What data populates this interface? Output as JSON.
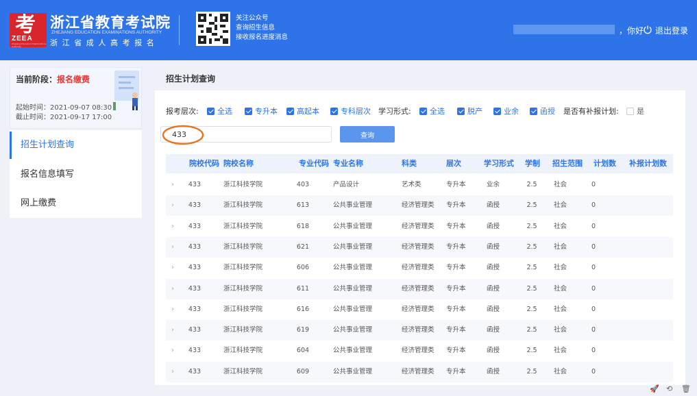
{
  "header": {
    "org_name": "浙江省教育考试院",
    "org_en": "ZHEJIANG EDUCATION EXAMINATIONS AUTHORITY",
    "org_sub": "浙江省成人高考报名",
    "logo_char": "考",
    "logo_text": "ZEEA",
    "logo_small": "Zhejiang Education Examinations Authority",
    "qr_lines": [
      "关注公众号",
      "查询招生信息",
      "接收报名进度消息"
    ],
    "greeting": "，你好",
    "logout": "退出登录"
  },
  "sidebar": {
    "stage_label": "当前阶段：",
    "stage_value": "报名缴费",
    "start_time": "起始时间：2021-09-07 08:30",
    "end_time": "截止时间：2021-09-17 17:00",
    "items": [
      {
        "label": "招生计划查询",
        "active": true
      },
      {
        "label": "报名信息填写",
        "active": false
      },
      {
        "label": "网上缴费",
        "active": false
      }
    ]
  },
  "main": {
    "title": "招生计划查询",
    "filters": {
      "level_label": "报考层次:",
      "level_options": [
        {
          "label": "全选",
          "checked": true
        },
        {
          "label": "专升本",
          "checked": true
        },
        {
          "label": "高起本",
          "checked": true
        },
        {
          "label": "专科层次",
          "checked": true
        }
      ],
      "form_label": "学习形式:",
      "form_options": [
        {
          "label": "全选",
          "checked": true
        },
        {
          "label": "脱产",
          "checked": true
        },
        {
          "label": "业余",
          "checked": true
        },
        {
          "label": "函授",
          "checked": true
        }
      ],
      "supplement_label": "是否有补报计划:",
      "supplement_option": {
        "label": "是",
        "checked": false
      }
    },
    "search": {
      "value": "433",
      "button": "查询"
    },
    "table": {
      "headers": [
        "院校代码",
        "院校名称",
        "专业代码",
        "专业名称",
        "科类",
        "层次",
        "学习形式",
        "学制",
        "招生范围",
        "计划数",
        "补报计划数"
      ],
      "rows": [
        [
          "433",
          "浙江科技学院",
          "403",
          "产品设计",
          "艺术类",
          "专升本",
          "业余",
          "2.5",
          "社会",
          "0",
          ""
        ],
        [
          "433",
          "浙江科技学院",
          "613",
          "公共事业管理",
          "经济管理类",
          "专升本",
          "函授",
          "2.5",
          "社会",
          "0",
          ""
        ],
        [
          "433",
          "浙江科技学院",
          "618",
          "公共事业管理",
          "经济管理类",
          "专升本",
          "函授",
          "2.5",
          "社会",
          "0",
          ""
        ],
        [
          "433",
          "浙江科技学院",
          "621",
          "公共事业管理",
          "经济管理类",
          "专升本",
          "函授",
          "2.5",
          "社会",
          "0",
          ""
        ],
        [
          "433",
          "浙江科技学院",
          "606",
          "公共事业管理",
          "经济管理类",
          "专升本",
          "函授",
          "2.5",
          "社会",
          "0",
          ""
        ],
        [
          "433",
          "浙江科技学院",
          "611",
          "公共事业管理",
          "经济管理类",
          "专升本",
          "函授",
          "2.5",
          "社会",
          "0",
          ""
        ],
        [
          "433",
          "浙江科技学院",
          "616",
          "公共事业管理",
          "经济管理类",
          "专升本",
          "函授",
          "2.5",
          "社会",
          "0",
          ""
        ],
        [
          "433",
          "浙江科技学院",
          "619",
          "公共事业管理",
          "经济管理类",
          "专升本",
          "函授",
          "2.5",
          "社会",
          "0",
          ""
        ],
        [
          "433",
          "浙江科技学院",
          "604",
          "公共事业管理",
          "经济管理类",
          "专升本",
          "函授",
          "2.5",
          "社会",
          "0",
          ""
        ],
        [
          "433",
          "浙江科技学院",
          "609",
          "公共事业管理",
          "经济管理类",
          "专升本",
          "函授",
          "2.5",
          "社会",
          "0",
          ""
        ]
      ]
    }
  },
  "colors": {
    "primary": "#2f73e8",
    "highlight": "#e03a3a",
    "annotation": "#e8731a"
  },
  "icons": [
    "power-icon",
    "chevron-right-icon",
    "rocket-icon",
    "refresh-icon",
    "trash-icon",
    "qr-code-icon"
  ]
}
